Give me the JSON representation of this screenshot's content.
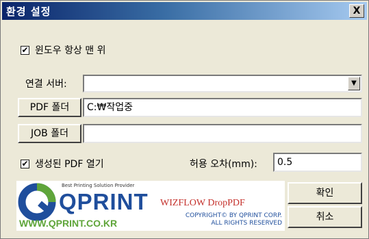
{
  "window": {
    "title": "환경 설정",
    "close_label": "X"
  },
  "always_on_top": {
    "label": "윈도우 항상 맨 위",
    "checked": "✔"
  },
  "connection_server": {
    "label": "연결 서버:",
    "value": ""
  },
  "pdf_folder": {
    "button_label": "PDF 폴더",
    "value": "C:₩작업중"
  },
  "job_folder": {
    "button_label": "JOB 폴더",
    "value": ""
  },
  "open_pdf": {
    "label": "생성된 PDF 열기",
    "checked": "✔"
  },
  "tolerance": {
    "label": "허용 오차(mm):",
    "value": "0.5"
  },
  "buttons": {
    "ok": "확인",
    "cancel": "취소"
  },
  "logo": {
    "tagline": "Best Printing Solution Provider",
    "brand": "QPRINT",
    "url": "WWW.QPRINT.CO.KR",
    "product": "WIZFLOW DropPDF",
    "copyright_line1": "COPYRIGHT© BY QPRINT CORP.",
    "copyright_line2": "ALL RIGHTS RESERVED"
  },
  "colors": {
    "title_bar": "#0a246a",
    "dialog_bg": "#ece9d8",
    "logo_green": "#5fa53a",
    "logo_blue": "#1f4e9c",
    "product_red": "#c4302b"
  }
}
